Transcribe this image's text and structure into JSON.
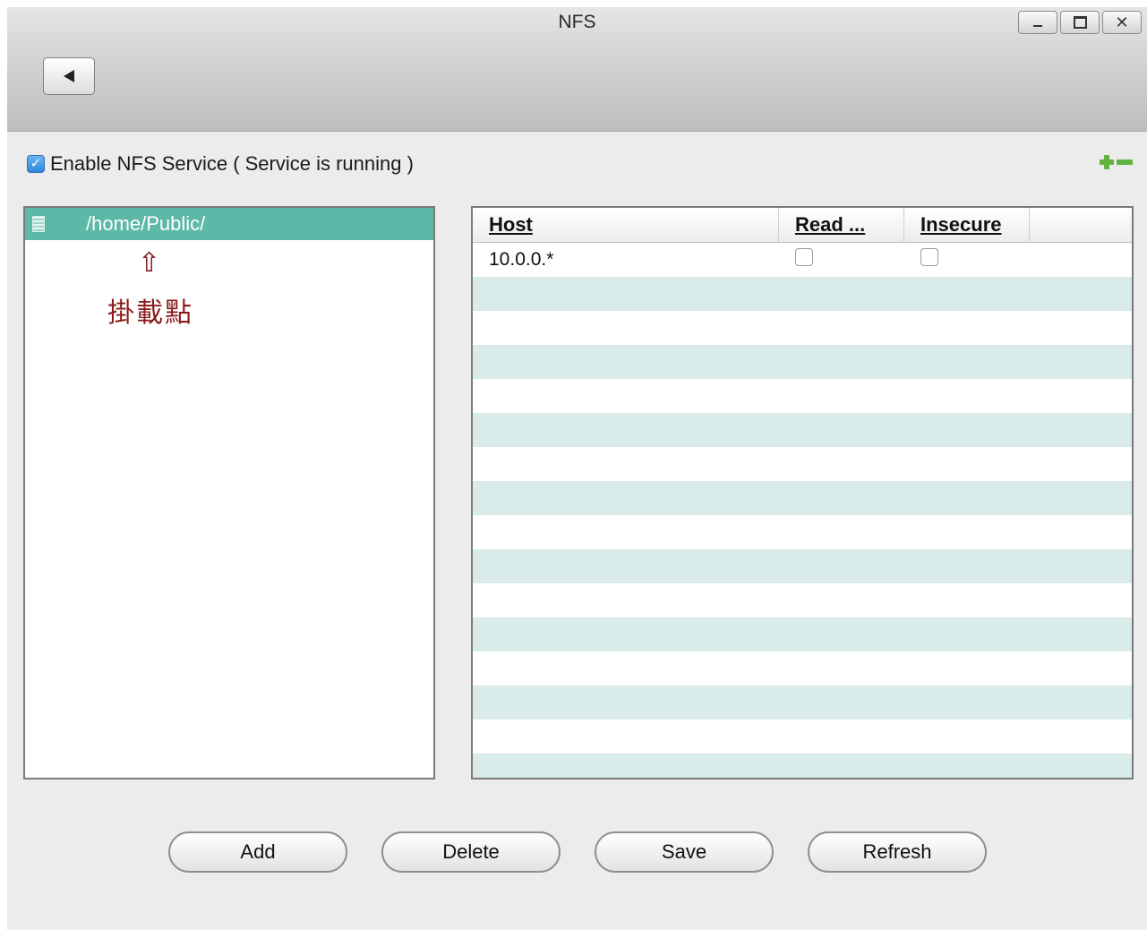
{
  "window": {
    "title": "NFS",
    "controls": [
      "minimize",
      "maximize",
      "close"
    ]
  },
  "service": {
    "checkbox_checked": true,
    "label": "Enable NFS Service ( Service is running )"
  },
  "mounts": {
    "items": [
      {
        "path": "/home/Public/",
        "selected": true
      }
    ],
    "annotation": {
      "arrow": "⇧",
      "label": "掛載點"
    }
  },
  "hosts_table": {
    "columns": [
      "Host",
      "Read ...",
      "Insecure"
    ],
    "rows": [
      {
        "host": "10.0.0.*",
        "read_only": false,
        "insecure": false
      }
    ]
  },
  "actions": {
    "add": "Add",
    "delete": "Delete",
    "save": "Save",
    "refresh": "Refresh"
  },
  "colors": {
    "selection": "#5db8a8",
    "stripe": "#d9ecea",
    "add_remove": "#5fb43d",
    "annotation": "#8b1a1a"
  }
}
